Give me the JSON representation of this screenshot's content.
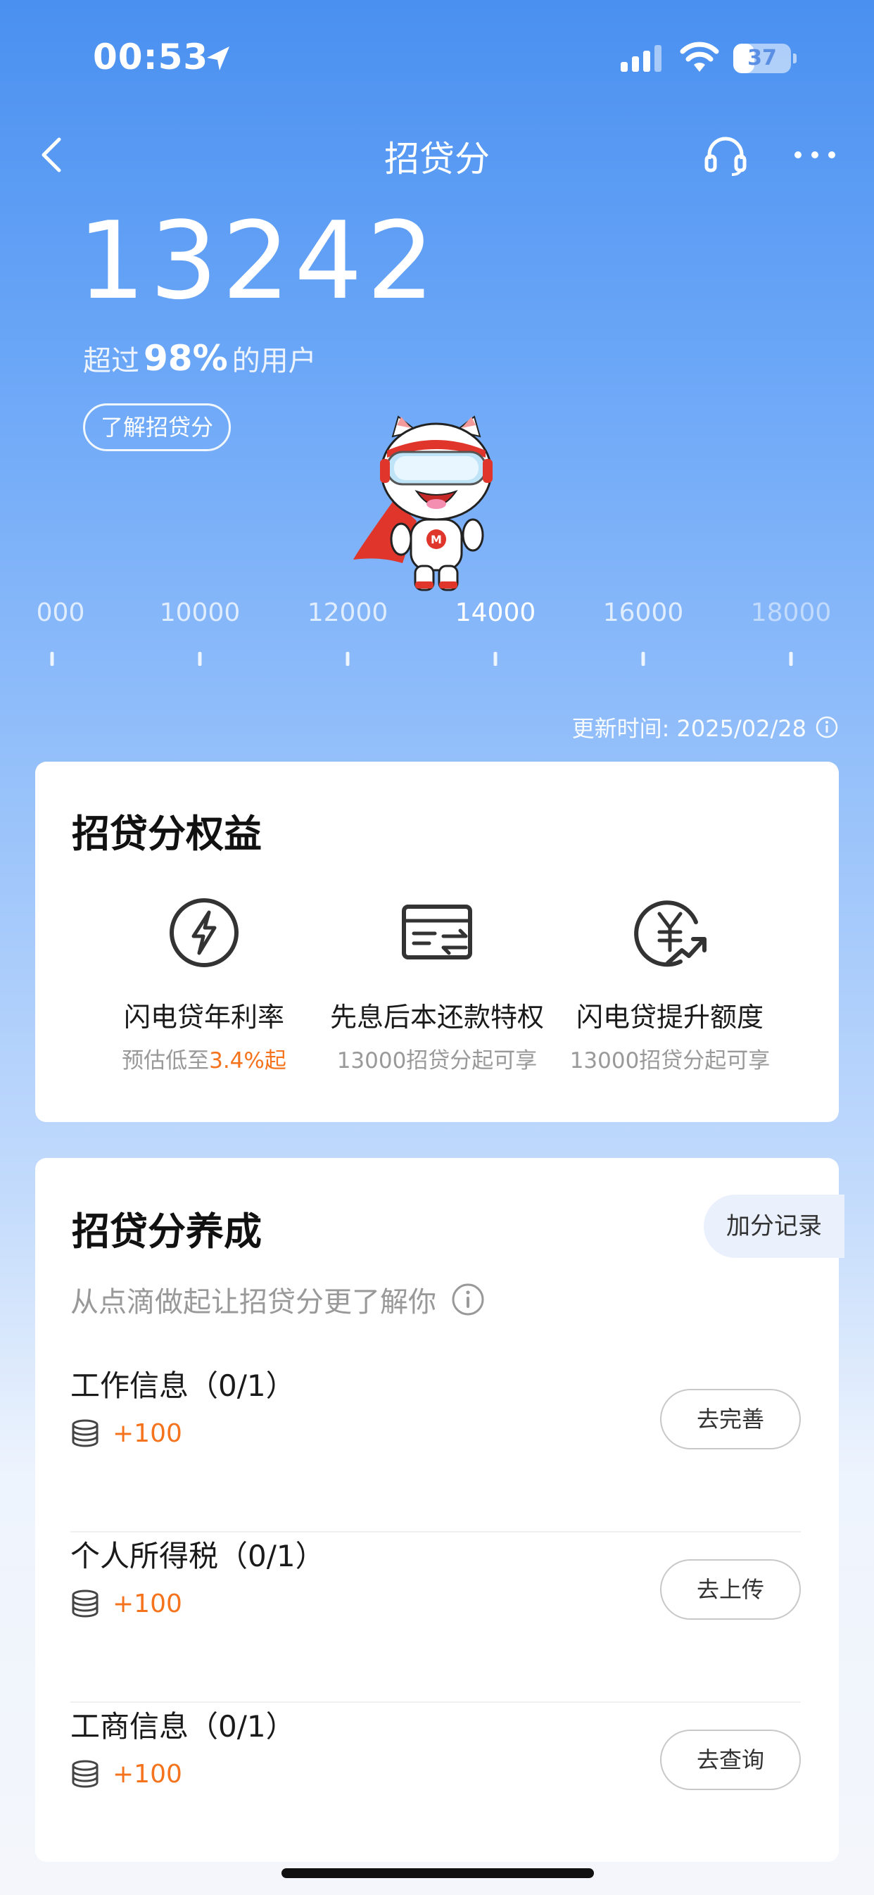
{
  "status_bar": {
    "time": "00:53",
    "battery": "37",
    "battery_level": 0.37
  },
  "nav": {
    "title": "招贷分"
  },
  "score": {
    "value": "13242",
    "exceed_prefix": "超过",
    "exceed_percent": "98%",
    "exceed_suffix": "的用户",
    "learn_button": "了解招贷分"
  },
  "scale": {
    "labels": [
      "000",
      "10000",
      "12000",
      "14000",
      "16000",
      "18000"
    ]
  },
  "update_time": "更新时间: 2025/02/28",
  "benefits": {
    "title": "招贷分权益",
    "items": [
      {
        "name": "闪电贷年利率",
        "sub_prefix": "预估低至",
        "sub_highlight": "3.4%起",
        "icon": "lightning-icon"
      },
      {
        "name": "先息后本还款特权",
        "sub": "13000招贷分起可享",
        "icon": "card-transfer-icon"
      },
      {
        "name": "闪电贷提升额度",
        "sub": "13000招贷分起可享",
        "icon": "yuan-up-icon"
      }
    ]
  },
  "cultivate": {
    "title": "招贷分养成",
    "record_button": "加分记录",
    "subtitle": "从点滴做起让招贷分更了解你",
    "tasks": [
      {
        "title": "工作信息（0/1）",
        "reward": "+100",
        "button": "去完善"
      },
      {
        "title": "个人所得税（0/1）",
        "reward": "+100",
        "button": "去上传"
      },
      {
        "title": "工商信息（0/1）",
        "reward": "+100",
        "button": "去查询"
      }
    ]
  },
  "colors": {
    "accent_orange": "#f5731d",
    "header_blue": "#4a90f0"
  }
}
